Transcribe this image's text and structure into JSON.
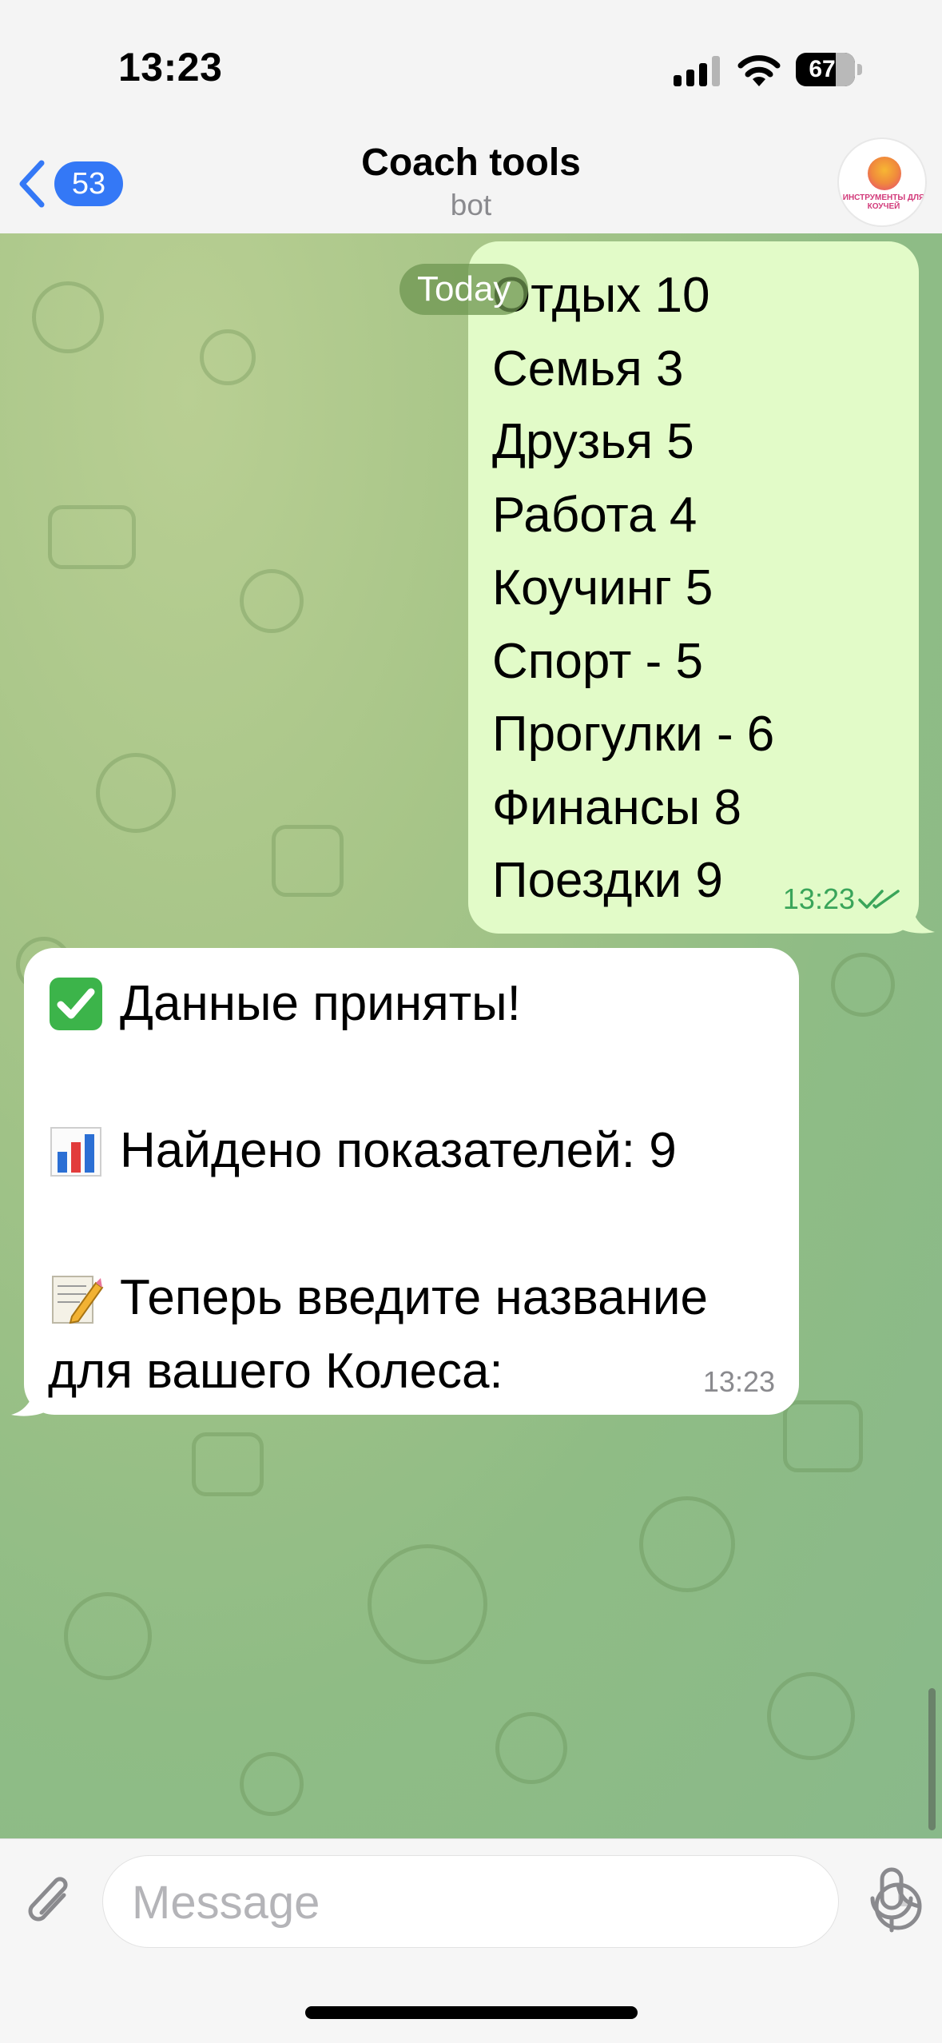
{
  "status_bar": {
    "time": "13:23",
    "battery_level": "67",
    "icons": [
      "signal-icon",
      "wifi-icon",
      "battery-icon"
    ]
  },
  "header": {
    "back_badge": "53",
    "title": "Coach tools",
    "subtitle": "bot",
    "avatar_text": "ИНСТРУМЕНТЫ ДЛЯ КОУЧЕЙ"
  },
  "chat": {
    "date_label": "Today",
    "outgoing": {
      "lines": [
        "Отдых 10",
        "Семья 3",
        "Друзья 5",
        "Работа 4",
        "Коучинг 5",
        "Спорт - 5",
        "Прогулки - 6",
        "Финансы 8",
        "Поездки 9"
      ],
      "time": "13:23",
      "status": "read"
    },
    "incoming": {
      "line1": "Данные приняты!",
      "line2": "Найдено показателей: 9",
      "line3": "Теперь введите название",
      "line4": "для вашего Колеса:",
      "time": "13:23"
    }
  },
  "composer": {
    "placeholder": "Message"
  },
  "colors": {
    "accent": "#3478f6",
    "outgoing_bubble": "#e2fbc8",
    "incoming_bubble": "#ffffff",
    "read_check": "#3aa55a"
  }
}
